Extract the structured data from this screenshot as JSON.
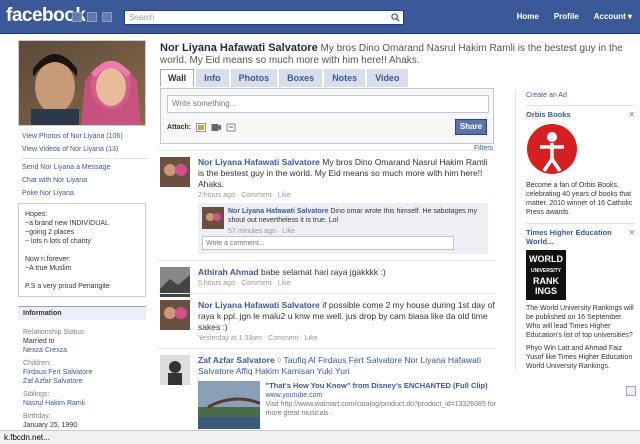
{
  "header": {
    "logo": "facebook",
    "search_placeholder": "Search",
    "nav": [
      "Home",
      "Profile",
      "Account ▾"
    ]
  },
  "profile": {
    "name": "Nor Liyana Hafawati Salvatore",
    "status": "My bros Dino Omarand Nasrul Hakim Ramli is the bestest guy in the world. My Eid means so much more with him here!! Ahaks."
  },
  "tabs": [
    "Wall",
    "Info",
    "Photos",
    "Boxes",
    "Notes",
    "Video"
  ],
  "left_links": [
    "View Photos of Nor Liyana (106)",
    "View Videos of Nor Liyana (13)",
    "Send Nor Liyana a Message",
    "Chat with Nor Liyana",
    "Poke Nor Liyana"
  ],
  "bio": {
    "lines": [
      "Hopes:",
      "~a brand new INDIVIDUAL",
      "~going 2 places",
      "~ lots n lots of charity",
      "",
      "Now n forever:",
      "~A true Muslim",
      "",
      "P.S a very proud Penangite"
    ]
  },
  "info": {
    "title": "Information",
    "items": [
      {
        "label": "Relationship Status:",
        "value": "Married to",
        "link": "Nexza Crexza"
      },
      {
        "label": "Children:",
        "value": "",
        "link": "Firdaus Fert Salvatore\nZaf Azfar Salvatore"
      },
      {
        "label": "Siblings:",
        "value": "",
        "link": "Nasrul Hakim Ramli"
      },
      {
        "label": "Birthday:",
        "value": "January 25, 1990",
        "link": ""
      }
    ]
  },
  "composer": {
    "placeholder": "Write something...",
    "attach_label": "Attach:",
    "share_label": "Share"
  },
  "filters_label": "Filters",
  "stream": [
    {
      "author": "Nor Liyana Hafawati Salvatore",
      "text": "My bros Dino Omarand Nasrul Hakim Ramli is the bestest guy in the world. My Eid means so much more with him here!! Ahaks.",
      "meta": "2 hours ago · Comment · Like",
      "comment": {
        "author": "Nor Liyana Hafawati Salvatore",
        "text": "Dino omar wrote this himself. He sabotages my shout out nevertheless it is true. Lol",
        "meta": "57 minutes ago · Like"
      },
      "comment_placeholder": "Write a comment..."
    },
    {
      "author": "Athirah Ahmad",
      "text": "babe selamat hari raya jgakkkk :)",
      "meta": "5 hours ago · Comment · Like"
    },
    {
      "author": "Nor Liyana Hafawati Salvatore",
      "text": "if possible come 2 my house during 1st day of raya k ppl. jgn le malu2 u knw me well. jus drop by cam biasa like da old time sakes :)",
      "meta": "Yesterday at 1:33am · Comment · Like"
    },
    {
      "author": "Zaf Azfar Salvatore",
      "text": "Taufiq Al Firdaus Fert Salvatore Nor Liyana Hafawati Salvatore Affiq Hakim Kamisan Yuki Yuri",
      "link_title": "\"That's How You Know\" from Disney's ENCHANTED (Full Clip)",
      "link_url": "www.youtube.com",
      "link_desc": "Visit http://www.walmart.com/catalog/product.do?product_id=13326085 for more great musicals ·"
    }
  ],
  "right": {
    "create_ad": "Create an Ad",
    "ads": [
      {
        "title": "Orbis Books",
        "text": "Become a fan of Orbis Books, celebrating 40 years of books that matter. 2010 winner of 16 Catholic Press awards."
      },
      {
        "title": "Times Higher Education World...",
        "text": "The World University Rankings will be published on 16 September. Who will lead Times Higher Education's list of top universities?",
        "fans": "Phyo Win Latt and Ahmad Faiz Yusof like Times Higher Education World University Rankings."
      }
    ]
  },
  "statusbar": "k.fbcdn.net..."
}
